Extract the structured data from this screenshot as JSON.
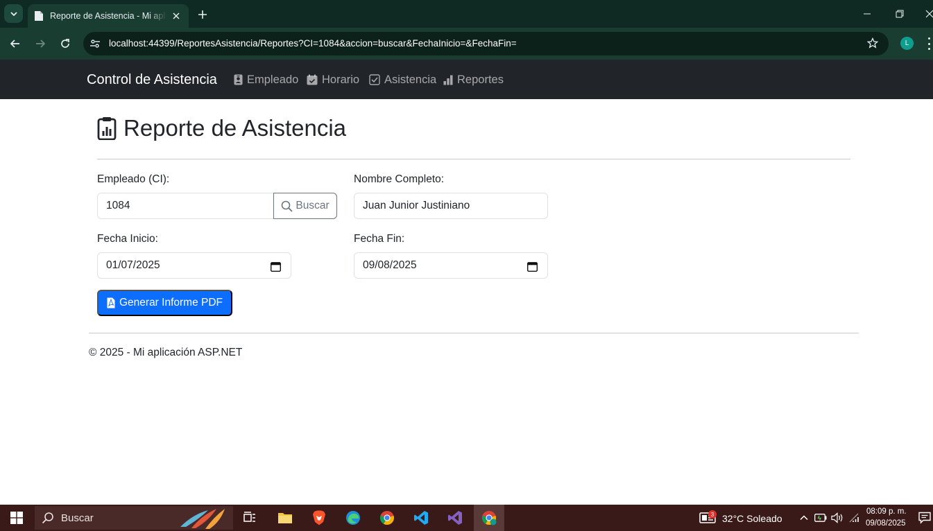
{
  "browser": {
    "tab_title": "Reporte de Asistencia - Mi aplicación ASP.NET",
    "url": "localhost:44399/ReportesAsistencia/Reportes?CI=1084&accion=buscar&FechaInicio=&FechaFin=",
    "profile_initial": "L"
  },
  "navbar": {
    "brand": "Control de Asistencia",
    "links": [
      {
        "label": "Empleado",
        "icon": "person-badge-icon"
      },
      {
        "label": "Horario",
        "icon": "calendar-check-icon"
      },
      {
        "label": "Asistencia",
        "icon": "check-square-icon"
      },
      {
        "label": "Reportes",
        "icon": "bar-chart-icon"
      }
    ]
  },
  "page": {
    "title": "Reporte de Asistencia",
    "title_icon": "clipboard-data-icon"
  },
  "form": {
    "ci_label": "Empleado (CI):",
    "ci_value": "1084",
    "search_button": "Buscar",
    "name_label": "Nombre Completo:",
    "name_value": "Juan Junior Justiniano",
    "start_label": "Fecha Inicio:",
    "start_value": "01/07/2025",
    "end_label": "Fecha Fin:",
    "end_value": "09/08/2025",
    "pdf_button": "Generar Informe PDF"
  },
  "footer": {
    "text": "© 2025 - Mi aplicación ASP.NET"
  },
  "taskbar": {
    "search_placeholder": "Buscar",
    "weather": "32°C  Soleado",
    "weather_badge": "3",
    "time": "08:09 p. m.",
    "date": "09/08/2025"
  },
  "colors": {
    "navbar_bg": "#212529",
    "primary": "#0d6efd",
    "browser_frame": "#1a3d31",
    "taskbar_bg": "#3a1a18"
  }
}
